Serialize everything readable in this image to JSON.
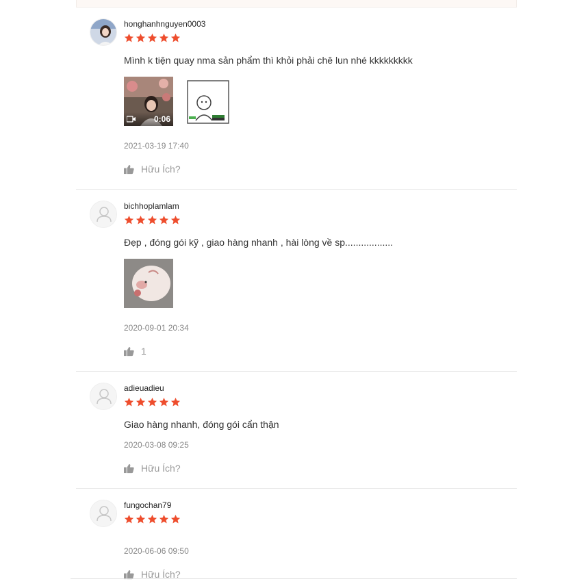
{
  "colors": {
    "star": "#ee4d2d",
    "helpful": "#999999"
  },
  "reviews": [
    {
      "username": "honghanhnguyen0003",
      "rating": 5,
      "comment": "Mình k tiện quay nma sản phẩm thì khỏi phải chê lun nhé kkkkkkkkk",
      "media": [
        {
          "type": "video",
          "duration": "0:06"
        },
        {
          "type": "image",
          "icon": "cartoon-sticker-icon"
        }
      ],
      "date": "2021-03-19 17:40",
      "helpful": "Hữu Ích?"
    },
    {
      "username": "bichhoplamlam",
      "rating": 5,
      "comment": "Đẹp , đóng gói kỹ , giao hàng nhanh , hài lòng về sp..................",
      "media": [
        {
          "type": "image",
          "icon": "product-photo-icon"
        }
      ],
      "date": "2020-09-01 20:34",
      "helpful": "1"
    },
    {
      "username": "adieuadieu",
      "rating": 5,
      "comment": "Giao hàng nhanh, đóng gói cẩn thận",
      "media": [],
      "date": "2020-03-08 09:25",
      "helpful": "Hữu Ích?"
    },
    {
      "username": "fungochan79",
      "rating": 5,
      "comment": "",
      "media": [],
      "date": "2020-06-06 09:50",
      "helpful": "Hữu Ích?"
    }
  ]
}
